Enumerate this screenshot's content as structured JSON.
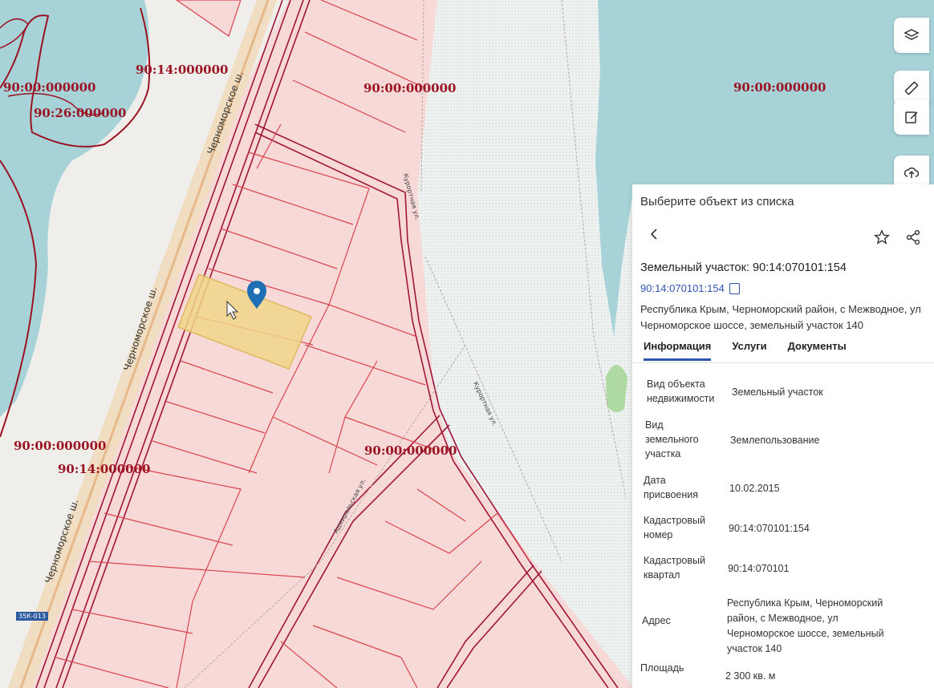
{
  "map": {
    "zone_labels": [
      "90:00:000000",
      "90:14:000000",
      "90:26:000000",
      "90:00:000000",
      "90:00:000000",
      "90:00:000000",
      "90:14:000000",
      "90:00:000000"
    ],
    "street_labels": [
      "Черноморское ш.",
      "Черноморское ш.",
      "Черноморское ш.",
      "Курортная ул.",
      "Курортная ул.",
      "Адмиральская ул."
    ],
    "road_badge": "35К-013",
    "colors": {
      "water": "#a3d6d9",
      "parcel_fill": "#f6d5d3",
      "parcel_line": "#d9454e",
      "road_line": "#a0153a",
      "selected_fill": "#f0d58a",
      "marker": "#1f6fb5"
    }
  },
  "toolbar": {
    "icons": [
      "layers-icon",
      "ruler-icon",
      "edit-icon",
      "upload-icon"
    ]
  },
  "panel": {
    "header": "Выберите объект из списка",
    "title": "Земельный участок: 90:14:070101:154",
    "cad_number_link": "90:14:070101:154",
    "address": "Республика Крым, Черноморский район, с Межводное, ул Черноморское шоссе, земельный участок 140",
    "tabs": [
      "Информация",
      "Услуги",
      "Документы"
    ],
    "active_tab": "Информация",
    "rows": [
      {
        "key": "Вид объекта недвижимости",
        "value": "Земельный участок"
      },
      {
        "key": "Вид земельного участка",
        "value": "Землепользование"
      },
      {
        "key": "Дата присвоения",
        "value": "10.02.2015"
      },
      {
        "key": "Кадастровый номер",
        "value": "90:14:070101:154"
      },
      {
        "key": "Кадастровый квартал",
        "value": "90:14:070101"
      },
      {
        "key": "Адрес",
        "value": "Республика Крым, Черноморский район, с Межводное, ул Черноморское шоссе, земельный участок 140"
      },
      {
        "key": "Площадь",
        "value": "2 300 кв. м"
      }
    ]
  }
}
